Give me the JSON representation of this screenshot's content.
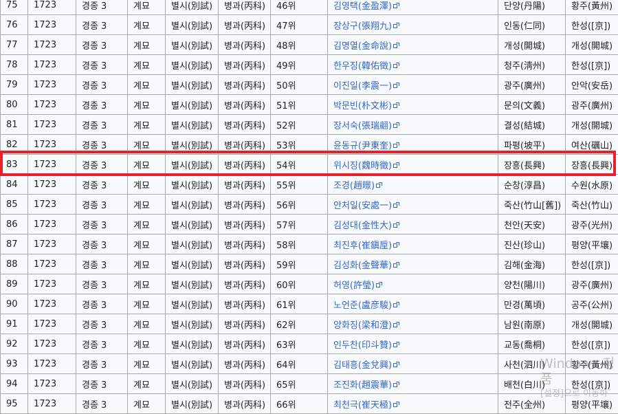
{
  "table": {
    "rows": [
      {
        "no": "75",
        "year": "1723",
        "reign": "경종 3",
        "ganji": "계묘",
        "exam": "별시(別試)",
        "subject": "병과(丙科)",
        "rank": "46위",
        "name": "김영택(金盈澤)",
        "origin": "단양(丹陽)",
        "residence": "황주(黃州)"
      },
      {
        "no": "76",
        "year": "1723",
        "reign": "경종 3",
        "ganji": "계묘",
        "exam": "별시(別試)",
        "subject": "병과(丙科)",
        "rank": "47위",
        "name": "장상구(張翔九)",
        "origin": "인동(仁同)",
        "residence": "한성([京])"
      },
      {
        "no": "77",
        "year": "1723",
        "reign": "경종 3",
        "ganji": "계묘",
        "exam": "별시(別試)",
        "subject": "병과(丙科)",
        "rank": "48위",
        "name": "김명열(金命說)",
        "origin": "개성(開城)",
        "residence": "개성(開城)"
      },
      {
        "no": "78",
        "year": "1723",
        "reign": "경종 3",
        "ganji": "계묘",
        "exam": "별시(別試)",
        "subject": "병과(丙科)",
        "rank": "49위",
        "name": "한우징(韓佑徵)",
        "origin": "청주(淸州)",
        "residence": "한성([京])"
      },
      {
        "no": "79",
        "year": "1723",
        "reign": "경종 3",
        "ganji": "계묘",
        "exam": "별시(別試)",
        "subject": "병과(丙科)",
        "rank": "50위",
        "name": "이진일(李震一)",
        "origin": "광주(廣州)",
        "residence": "안악(安岳)"
      },
      {
        "no": "80",
        "year": "1723",
        "reign": "경종 3",
        "ganji": "계묘",
        "exam": "별시(別試)",
        "subject": "병과(丙科)",
        "rank": "51위",
        "name": "박문빈(朴文彬)",
        "origin": "문의(文義)",
        "residence": "광주(廣州)"
      },
      {
        "no": "81",
        "year": "1723",
        "reign": "경종 3",
        "ganji": "계묘",
        "exam": "별시(別試)",
        "subject": "병과(丙科)",
        "rank": "52위",
        "name": "장서숙(張瑞翽)",
        "origin": "결성(結城)",
        "residence": "개성(開城)"
      },
      {
        "no": "82",
        "year": "1723",
        "reign": "경종 3",
        "ganji": "계묘",
        "exam": "별시(別試)",
        "subject": "병과(丙科)",
        "rank": "53위",
        "name": "윤동규(尹東奎)",
        "origin": "파평(坡平)",
        "residence": "여산(礪山)"
      },
      {
        "no": "83",
        "year": "1723",
        "reign": "경종 3",
        "ganji": "계묘",
        "exam": "별시(別試)",
        "subject": "병과(丙科)",
        "rank": "54위",
        "name": "위시징(魏時徵)",
        "origin": "장흥(長興)",
        "residence": "장흥(長興)"
      },
      {
        "no": "84",
        "year": "1723",
        "reign": "경종 3",
        "ganji": "계묘",
        "exam": "별시(別試)",
        "subject": "병과(丙科)",
        "rank": "55위",
        "name": "조경(趙暻)",
        "origin": "순창(淳昌)",
        "residence": "수원(水原)"
      },
      {
        "no": "85",
        "year": "1723",
        "reign": "경종 3",
        "ganji": "계묘",
        "exam": "별시(別試)",
        "subject": "병과(丙科)",
        "rank": "56위",
        "name": "안처일(安處一)",
        "origin": "죽산(竹山[舊])",
        "residence": "죽산(竹山)"
      },
      {
        "no": "86",
        "year": "1723",
        "reign": "경종 3",
        "ganji": "계묘",
        "exam": "별시(別試)",
        "subject": "병과(丙科)",
        "rank": "57위",
        "name": "김성대(金性大)",
        "origin": "천안(天安)",
        "residence": "광주(光州)"
      },
      {
        "no": "87",
        "year": "1723",
        "reign": "경종 3",
        "ganji": "계묘",
        "exam": "별시(別試)",
        "subject": "병과(丙科)",
        "rank": "58위",
        "name": "최진후(崔鎭垕)",
        "origin": "진산(珍山)",
        "residence": "평양(平壤)"
      },
      {
        "no": "88",
        "year": "1723",
        "reign": "경종 3",
        "ganji": "계묘",
        "exam": "별시(別試)",
        "subject": "병과(丙科)",
        "rank": "59위",
        "name": "김성화(金聲華)",
        "origin": "김해(金海)",
        "residence": "한성([京])"
      },
      {
        "no": "89",
        "year": "1723",
        "reign": "경종 3",
        "ganji": "계묘",
        "exam": "별시(別試)",
        "subject": "병과(丙科)",
        "rank": "60위",
        "name": "허영(許瑩)",
        "origin": "양천(陽川)",
        "residence": "광주(廣州)"
      },
      {
        "no": "90",
        "year": "1723",
        "reign": "경종 3",
        "ganji": "계묘",
        "exam": "별시(別試)",
        "subject": "병과(丙科)",
        "rank": "61위",
        "name": "노언준(盧彦駿)",
        "origin": "만경(萬頃)",
        "residence": "공주(公州)"
      },
      {
        "no": "91",
        "year": "1723",
        "reign": "경종 3",
        "ganji": "계묘",
        "exam": "별시(別試)",
        "subject": "병과(丙科)",
        "rank": "62위",
        "name": "양화징(梁和澄)",
        "origin": "남원(南原)",
        "residence": "개성(開城)"
      },
      {
        "no": "92",
        "year": "1723",
        "reign": "경종 3",
        "ganji": "계묘",
        "exam": "별시(別試)",
        "subject": "병과(丙科)",
        "rank": "63위",
        "name": "인두찬(印斗贊)",
        "origin": "교동(喬桐)",
        "residence": "한성([京])"
      },
      {
        "no": "93",
        "year": "1723",
        "reign": "경종 3",
        "ganji": "계묘",
        "exam": "별시(別試)",
        "subject": "병과(丙科)",
        "rank": "64위",
        "name": "김태흥(金兌興)",
        "origin": "사천(泗川)",
        "residence": "황주(黃州)"
      },
      {
        "no": "94",
        "year": "1723",
        "reign": "경종 3",
        "ganji": "계묘",
        "exam": "별시(別試)",
        "subject": "병과(丙科)",
        "rank": "65위",
        "name": "조진화(趙震華)",
        "origin": "배천(白川)",
        "residence": "한성([京])"
      },
      {
        "no": "95",
        "year": "1723",
        "reign": "경종 3",
        "ganji": "계묘",
        "exam": "별시(別試)",
        "subject": "병과(丙科)",
        "rank": "66위",
        "name": "최천극(崔天極)",
        "origin": "전주(全州)",
        "residence": "평양(平壤)"
      }
    ]
  },
  "highlight": {
    "row_no": "83",
    "color": "#e8202a"
  },
  "watermark": {
    "title": "Windows 정품",
    "subtitle": "[설정]으로 이동하"
  },
  "colors": {
    "link": "#3366cc",
    "row_bg": "#f8f9fa",
    "border": "#a2a9b1"
  }
}
